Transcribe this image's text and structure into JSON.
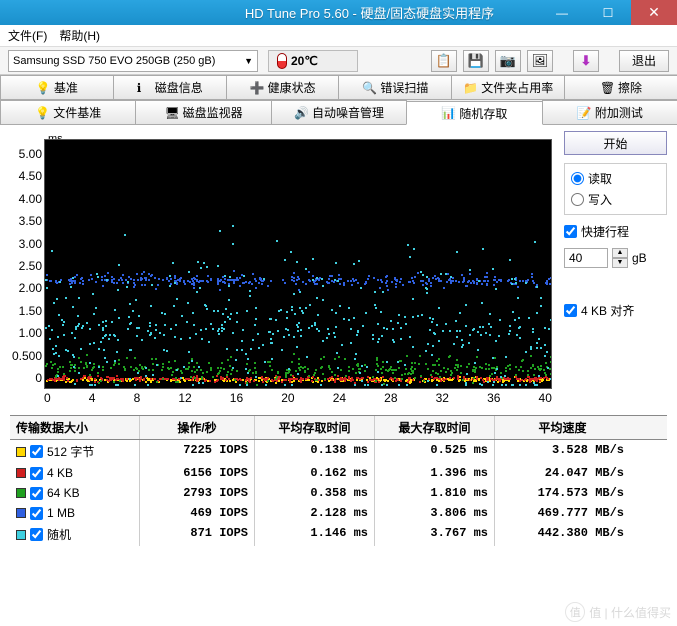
{
  "window": {
    "title": "HD Tune Pro 5.60 - 硬盘/固态硬盘实用程序",
    "min": "—",
    "max": "☐",
    "close": "✕"
  },
  "menu": {
    "file": "文件(F)",
    "help": "帮助(H)"
  },
  "toolbar": {
    "drive": "Samsung SSD 750 EVO 250GB (250 gB)",
    "temp": "20℃",
    "icons": {
      "copy": "📋",
      "save": "💾",
      "camera": "📷",
      "picture": "🖼",
      "down": "⬇"
    },
    "exit": "退出"
  },
  "tabs_row1": [
    {
      "label": "基准",
      "icon": "💡"
    },
    {
      "label": "磁盘信息",
      "icon": "ℹ"
    },
    {
      "label": "健康状态",
      "icon": "➕"
    },
    {
      "label": "错误扫描",
      "icon": "🔍"
    },
    {
      "label": "文件夹占用率",
      "icon": "📁"
    },
    {
      "label": "擦除",
      "icon": "🗑"
    }
  ],
  "tabs_row2": [
    {
      "label": "文件基准",
      "icon": "💡"
    },
    {
      "label": "磁盘监视器",
      "icon": "🖥"
    },
    {
      "label": "自动噪音管理",
      "icon": "🔊"
    },
    {
      "label": "随机存取",
      "icon": "📊",
      "active": true
    },
    {
      "label": "附加测试",
      "icon": "📝"
    }
  ],
  "chart": {
    "y_unit": "ms",
    "y_ticks": [
      "5.00",
      "4.50",
      "4.00",
      "3.50",
      "3.00",
      "2.50",
      "2.00",
      "1.50",
      "1.00",
      "0.500",
      "0"
    ],
    "x_ticks": [
      "0",
      "4",
      "8",
      "12",
      "16",
      "20",
      "24",
      "28",
      "32",
      "36",
      "40"
    ],
    "x_unit": "gB"
  },
  "side": {
    "start": "开始",
    "read": "读取",
    "write": "写入",
    "short_stroke": "快捷行程",
    "short_stroke_val": "40",
    "short_stroke_unit": "gB",
    "align": "4 KB 对齐"
  },
  "table": {
    "headers": [
      "传输数据大小",
      "操作/秒",
      "平均存取时间",
      "最大存取时间",
      "平均速度"
    ],
    "rows": [
      {
        "color": "#ffd700",
        "label": "512 字节",
        "iops": "7225 IOPS",
        "avg": "0.138 ms",
        "max": "0.525 ms",
        "speed": "3.528 MB/s"
      },
      {
        "color": "#d02020",
        "label": "4 KB",
        "iops": "6156 IOPS",
        "avg": "0.162 ms",
        "max": "1.396 ms",
        "speed": "24.047 MB/s"
      },
      {
        "color": "#20a020",
        "label": "64 KB",
        "iops": "2793 IOPS",
        "avg": "0.358 ms",
        "max": "1.810 ms",
        "speed": "174.573 MB/s"
      },
      {
        "color": "#3060e0",
        "label": "1 MB",
        "iops": "469 IOPS",
        "avg": "2.128 ms",
        "max": "3.806 ms",
        "speed": "469.777 MB/s"
      },
      {
        "color": "#40d0e0",
        "label": "随机",
        "iops": "871 IOPS",
        "avg": "1.146 ms",
        "max": "3.767 ms",
        "speed": "442.380 MB/s"
      }
    ]
  },
  "chart_data": {
    "type": "scatter",
    "title": "",
    "xlabel": "gB",
    "ylabel": "ms",
    "xlim": [
      0,
      40
    ],
    "ylim": [
      0,
      5.0
    ],
    "series": [
      {
        "name": "512 字节",
        "color": "#ffd700",
        "band_center": 0.14,
        "band_spread": 0.06
      },
      {
        "name": "4 KB",
        "color": "#d02020",
        "band_center": 0.16,
        "band_spread": 0.08
      },
      {
        "name": "64 KB",
        "color": "#20a020",
        "band_center": 0.36,
        "band_spread": 0.35
      },
      {
        "name": "1 MB",
        "color": "#3060e0",
        "band_center": 2.13,
        "band_spread": 0.2
      },
      {
        "name": "随机",
        "color": "#40d0e0",
        "band_center": 1.15,
        "band_spread": 1.1
      }
    ]
  },
  "watermark": "值 | 什么值得买"
}
